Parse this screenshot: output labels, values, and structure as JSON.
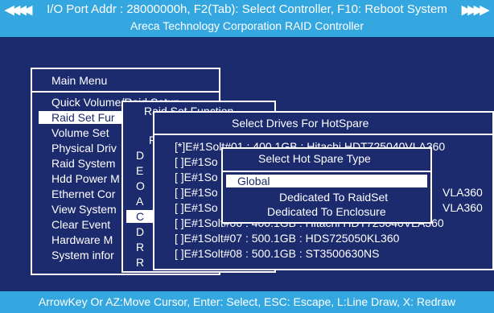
{
  "header": {
    "line1": "I/O Port Addr : 28000000h, F2(Tab): Select Controller, F10: Reboot System",
    "line2": "Areca Technology Corporation RAID Controller",
    "left_arrows": "◀◀◀◀",
    "right_arrows": "▶▶▶▶"
  },
  "main_menu": {
    "title": "Main Menu",
    "items": [
      "Quick Volume/Raid Setup",
      "Raid Set Fur",
      "Volume Set",
      "Physical Driv",
      "Raid System",
      "Hdd Power M",
      "Ethernet Cor",
      "View System",
      "Clear Event",
      "Hardware M",
      "System infor"
    ]
  },
  "raid_set_function": {
    "title": "Raid Set Function",
    "letters": [
      "F",
      "D",
      "E",
      "O",
      "A",
      "C",
      "D",
      "R",
      "R"
    ]
  },
  "select_drives": {
    "title": "Select Drives For HotSpare",
    "rows": [
      "[*]E#1Solt#01 : 400.1GB : Hitachi HDT725040VLA360",
      "[ ]E#1So",
      "[ ]E#1So",
      "[ ]E#1So",
      "[ ]E#1So",
      "[ ]E#1Solt#06 : 400.1GB : Hitachi HDT725040VLA360",
      "[ ]E#1Solt#07 : 500.1GB : HDS725050KL360",
      "[ ]E#1Solt#08 : 500.1GB : ST3500630NS"
    ],
    "right_fragments": [
      "0",
      "VLA360",
      "VLA360"
    ]
  },
  "hot_spare_type": {
    "title": "Select Hot Spare Type",
    "options": [
      "Global",
      "Dedicated To RaidSet",
      "Dedicated To Enclosure"
    ]
  },
  "footer": {
    "text": "ArrowKey Or AZ:Move Cursor, Enter: Select, ESC: Escape, L:Line Draw, X: Redraw"
  },
  "colors": {
    "background": "#1c2a6e",
    "bar": "#34a7e0",
    "text": "#ffffff"
  }
}
